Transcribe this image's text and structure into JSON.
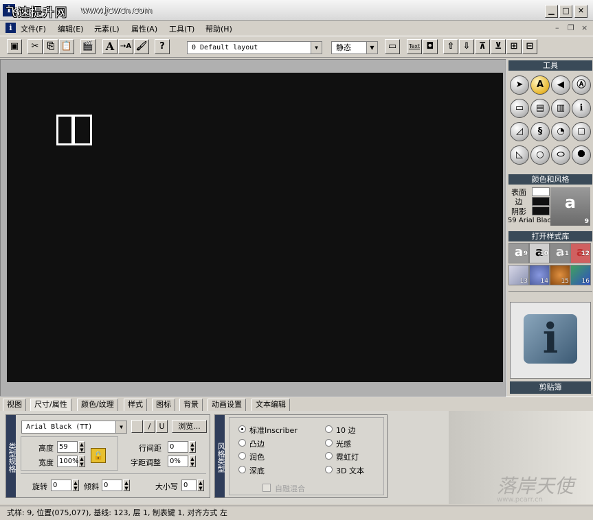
{
  "window": {
    "title": "飞速提升网",
    "url_overlay": "www.jcwcn.com",
    "app_icon": "i",
    "controls": {
      "minimize": "▁",
      "maximize": "□",
      "close": "✕"
    }
  },
  "menu": {
    "items": [
      "文件(F)",
      "编辑(E)",
      "元素(L)",
      "属性(A)",
      "工具(T)",
      "帮助(H)"
    ],
    "mdi_controls": {
      "minimize": "–",
      "restore": "❐",
      "close": "×"
    }
  },
  "toolbar": {
    "layout_combo": "0 Default layout",
    "state_combo": "静态",
    "text_btn": "Text",
    "help_btn": "?",
    "font_btn": "A"
  },
  "tools_panel": {
    "title": "工具",
    "tools": [
      "cursor",
      "text",
      "paint",
      "outline-text",
      "frame",
      "rect-fill",
      "rect-outline",
      "info",
      "triangle",
      "spiral",
      "pie",
      "rounded-rect",
      "shape",
      "circle",
      "oval",
      "octagon"
    ]
  },
  "color_panel": {
    "title": "颜色和风格",
    "labels": [
      "表面",
      "边",
      "阴影"
    ],
    "preview_letter": "a",
    "preview_num": "9",
    "font_line": "59 Arial Black"
  },
  "style_library": {
    "title": "打开样式库",
    "cells": [
      {
        "num": "9",
        "label": "a"
      },
      {
        "num": "10",
        "label": "a"
      },
      {
        "num": "11",
        "label": "a"
      },
      {
        "num": "12",
        "label": "a"
      },
      {
        "num": "13",
        "label": ""
      },
      {
        "num": "14",
        "label": ""
      },
      {
        "num": "15",
        "label": ""
      },
      {
        "num": "16",
        "label": ""
      }
    ]
  },
  "clipboard": {
    "title": "剪贴簿",
    "logo": "i"
  },
  "tabs": [
    "视图",
    "尺寸/属性",
    "颜色/纹理",
    "样式",
    "图标",
    "背景",
    "动画设置",
    "文本编辑"
  ],
  "type_spec": {
    "vlabel": "类型规格",
    "font": "Arial Black (TT)",
    "fmt_buttons": [
      "",
      "/",
      "U"
    ],
    "browse": "浏览...",
    "height_label": "高度",
    "height_value": "59",
    "width_label": "宽度",
    "width_value": "100%",
    "line_spacing_label": "行间距",
    "line_spacing_value": "0",
    "kerning_label": "字距调整",
    "kerning_value": "0%",
    "rotate_label": "旋转",
    "rotate_value": "0",
    "skew_label": "倾斜",
    "skew_value": "0",
    "case_label": "大小写",
    "case_value": "0"
  },
  "style_type": {
    "vlabel": "风格类型",
    "options_left": [
      "标准Inscriber",
      "凸边",
      "润色",
      "深底"
    ],
    "options_right": [
      "10 边",
      "光感",
      "霓虹灯",
      "3D 文本"
    ],
    "selected": "标准Inscriber",
    "checkbox_label": "自融混合"
  },
  "watermark": "落岸天使",
  "watermark_url": "www.pcarr.cn",
  "status": "式样: 9, 位置(075,077), 基线: 123, 层 1, 制表键 1, 对齐方式 左",
  "colors": {
    "canvas": "#101010",
    "panel_head": "#3a4a58",
    "vlabel": "#2f3d5a",
    "tool_active": "#e8b830"
  }
}
